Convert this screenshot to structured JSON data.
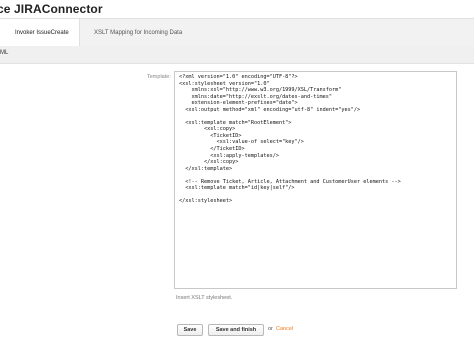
{
  "page": {
    "title": "ce JIRAConnector"
  },
  "tabs": [
    {
      "label": "Invoker IssueCreate",
      "active": true
    },
    {
      "label": "XSLT Mapping for Incoming Data",
      "active": false
    }
  ],
  "section": {
    "label": "ML"
  },
  "form": {
    "template_label": "Template:",
    "template_value": "<?xml version=\"1.0\" encoding=\"UTF-8\"?>\n<xsl:stylesheet version=\"1.0\"\n    xmlns:xsl=\"http://www.w3.org/1999/XSL/Transform\"\n    xmlns:date=\"http://exslt.org/dates-and-times\"\n    extension-element-prefixes=\"date\">\n  <xsl:output method=\"xml\" encoding=\"utf-8\" indent=\"yes\"/>\n\n  <xsl:template match=\"RootElement\">\n        <xsl:copy>\n          <TicketID>\n            <xsl:value-of select=\"key\"/>\n          </TicketID>\n          <xsl:apply-templates/>\n        </xsl:copy>\n  </xsl:template>\n\n  <!-- Remove Ticket, Article, Attachment and CustomerUser elements -->\n  <xsl:template match=\"id|key|self\"/>\n\n</xsl:stylesheet>",
    "help_text": "Insert XSLT stylesheet."
  },
  "actions": {
    "save_label": "Save",
    "save_finish_label": "Save and finish",
    "or_text": "or",
    "cancel_label": "Cancel"
  },
  "colors": {
    "cancel_link": "#f07a1a",
    "tab_bar_bg": "#f2f2f2"
  }
}
